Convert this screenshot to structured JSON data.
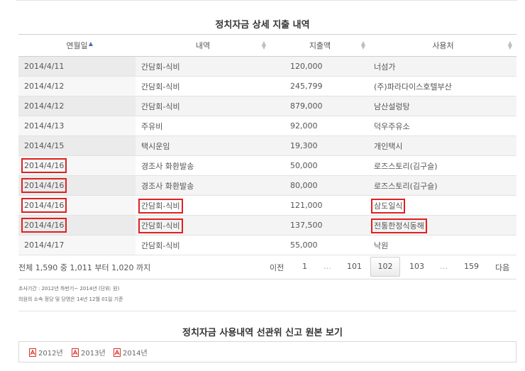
{
  "section1_title": "정치자금 상세 지출 내역",
  "section2_title": "정치자금 사용내역 선관위 신고 원본 보기",
  "table": {
    "headers": [
      "연월일",
      "내역",
      "지출액",
      "사용처"
    ],
    "sort_column": "연월일",
    "sort_direction": "ascending",
    "rows": [
      {
        "date": "2014/4/11",
        "item": "간담회-식비",
        "amount": "120,000",
        "place": "너섬가"
      },
      {
        "date": "2014/4/12",
        "item": "간담회-식비",
        "amount": "245,799",
        "place": "(주)파라다이스호텔부산"
      },
      {
        "date": "2014/4/12",
        "item": "간담회-식비",
        "amount": "879,000",
        "place": "남산설렁탕"
      },
      {
        "date": "2014/4/13",
        "item": "주유비",
        "amount": "92,000",
        "place": "덕우주유소"
      },
      {
        "date": "2014/4/15",
        "item": "택시운임",
        "amount": "19,300",
        "place": "개인택시"
      },
      {
        "date": "2014/4/16",
        "item": "경조사 화환발송",
        "amount": "50,000",
        "place": "로즈스토리(김구슬)"
      },
      {
        "date": "2014/4/16",
        "item": "경조사 화환발송",
        "amount": "80,000",
        "place": "로즈스토리(김구슬)"
      },
      {
        "date": "2014/4/16",
        "item": "간담회-식비",
        "amount": "121,000",
        "place": "삼도일식"
      },
      {
        "date": "2014/4/16",
        "item": "간담회-식비",
        "amount": "137,500",
        "place": "전통한정식동해"
      },
      {
        "date": "2014/4/17",
        "item": "간담회-식비",
        "amount": "55,000",
        "place": "낙원"
      }
    ]
  },
  "pagination": {
    "summary": "전체 1,590 중 1,011 부터 1,020 까지",
    "prev": "이전",
    "first": "1",
    "dots": "…",
    "p101": "101",
    "current": "102",
    "p103": "103",
    "last": "159",
    "next": "다음"
  },
  "notes": [
    "조사기간 : 2012년 하반기~ 2014년 (단위: 원)",
    "의원의 소속 정당 및 당명은 14년 12월 01일 기준"
  ],
  "files": [
    "2012년",
    "2013년",
    "2014년"
  ],
  "colors": {
    "highlight": "#e02020",
    "pdf": "#d9342b",
    "sort_active": "#4a6fb0"
  },
  "icons": {
    "pdf": "pdf-icon",
    "sort": "sort-arrows-icon"
  }
}
